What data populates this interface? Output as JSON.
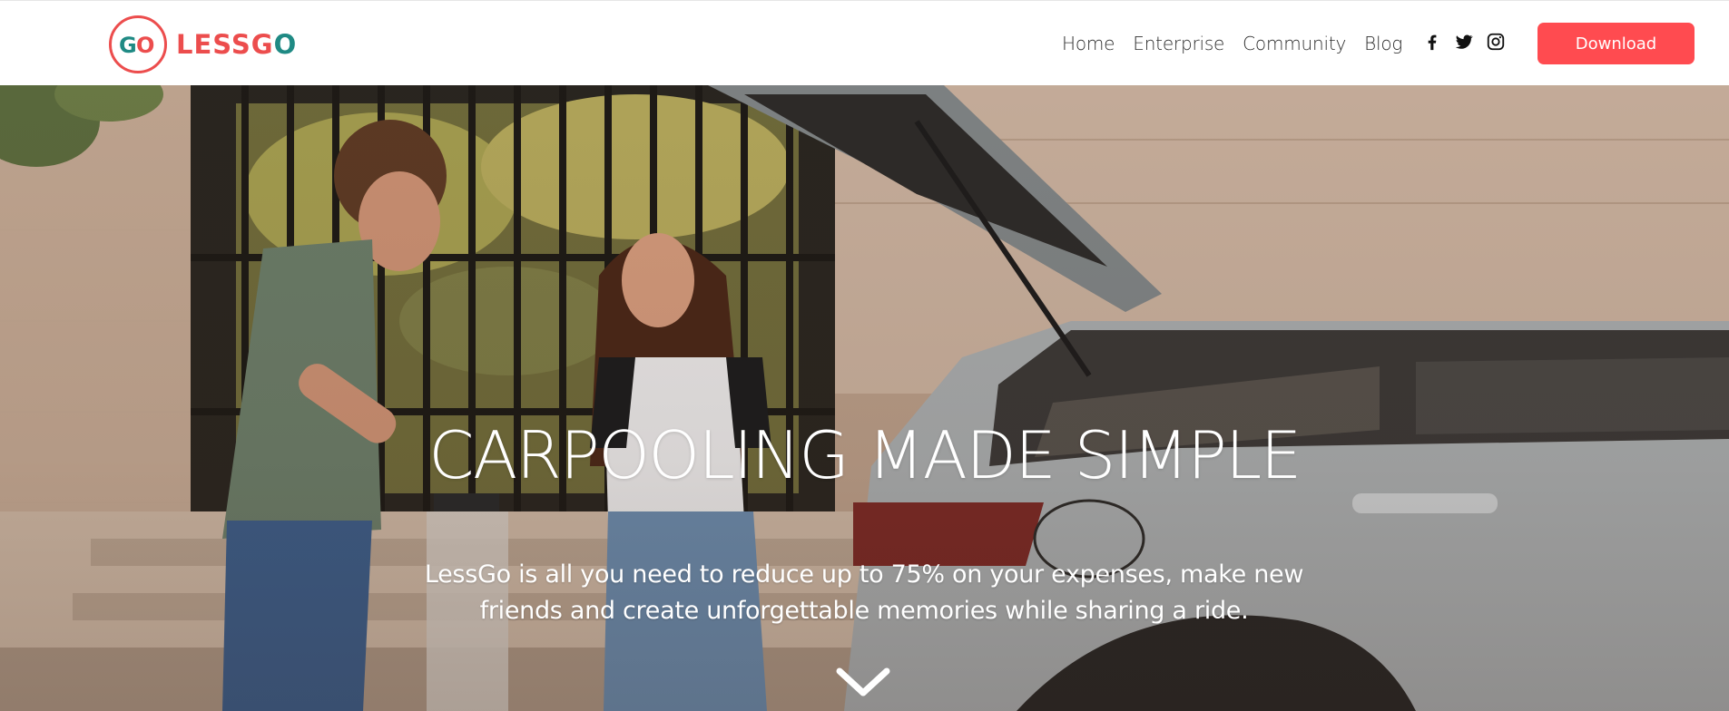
{
  "brand": {
    "name_part1": "LESS",
    "name_part2_g": "G",
    "name_part2_o": "O",
    "mark_g": "G",
    "mark_o": "O",
    "primary_color": "#ec4d4d",
    "secondary_color": "#1f8a84"
  },
  "nav": {
    "items": [
      {
        "label": "Home"
      },
      {
        "label": "Enterprise"
      },
      {
        "label": "Community"
      },
      {
        "label": "Blog"
      }
    ]
  },
  "social": {
    "icons": [
      "facebook-icon",
      "twitter-icon",
      "instagram-icon"
    ]
  },
  "header": {
    "download_label": "Download",
    "download_color": "#ff4b50"
  },
  "hero": {
    "title": "CARPOOLING MADE SIMPLE",
    "subtitle": "LessGo is all you need to reduce up to 75% on your expenses, make new friends and create unforgettable memories while sharing a ride.",
    "scroll_icon": "chevron-down-icon"
  }
}
